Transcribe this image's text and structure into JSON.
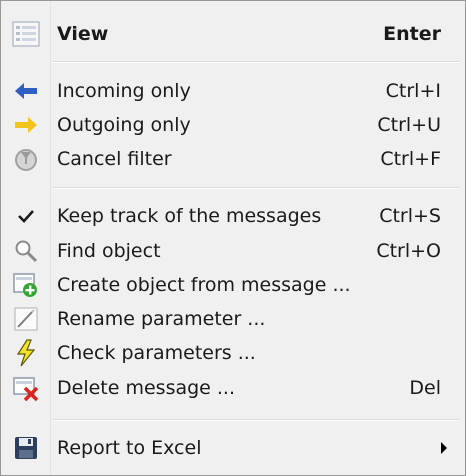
{
  "menu": {
    "view": {
      "label": "View",
      "shortcut": "Enter",
      "icon": "list-view-icon"
    },
    "incoming_only": {
      "label": "Incoming only",
      "shortcut": "Ctrl+I",
      "icon": "arrow-left-icon"
    },
    "outgoing_only": {
      "label": "Outgoing only",
      "shortcut": "Ctrl+U",
      "icon": "arrow-right-icon"
    },
    "cancel_filter": {
      "label": "Cancel filter",
      "shortcut": "Ctrl+F",
      "icon": "cancel-filter-icon"
    },
    "keep_track": {
      "label": "Keep track of the messages",
      "shortcut": "Ctrl+S",
      "icon": "checkmark-icon"
    },
    "find_object": {
      "label": "Find object",
      "shortcut": "Ctrl+O",
      "icon": "magnifier-icon"
    },
    "create_object": {
      "label": "Create object from message ...",
      "icon": "add-object-icon"
    },
    "rename_parameter": {
      "label": "Rename parameter ...",
      "icon": "rename-icon"
    },
    "check_parameters": {
      "label": "Check parameters ...",
      "icon": "lightning-icon"
    },
    "delete_message": {
      "label": "Delete message ...",
      "shortcut": "Del",
      "icon": "delete-icon"
    },
    "report_excel": {
      "label": "Report to Excel",
      "icon": "floppy-disk-icon",
      "has_submenu": true
    }
  },
  "colors": {
    "menu_background": "#f0f0f0",
    "incoming_arrow": "#2f5fc4",
    "outgoing_arrow": "#f0c419",
    "check_lightning": "#f5e22a",
    "delete_x": "#d8261f",
    "create_plus": "#35a336"
  }
}
